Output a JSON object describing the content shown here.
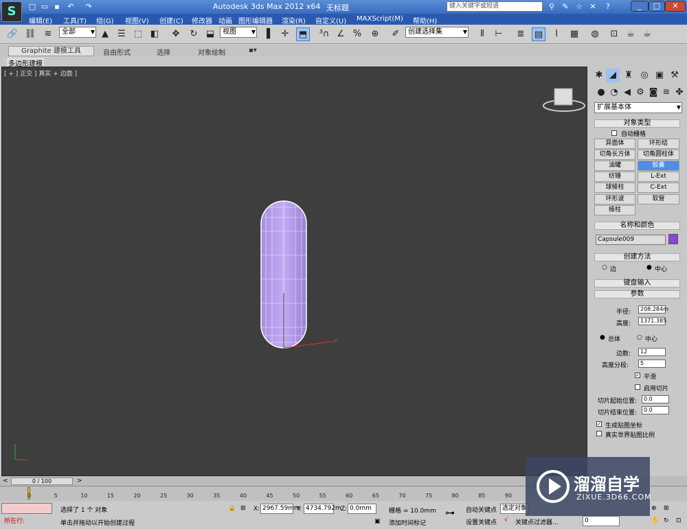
{
  "titlebar": {
    "title": "Autodesk 3ds Max  2012 x64",
    "file": "无标题",
    "search_placeholder": "键入关键字或短语"
  },
  "menu": [
    "编辑(E)",
    "工具(T)",
    "组(G)",
    "视图(V)",
    "创建(C)",
    "修改器",
    "动画",
    "图形编辑器",
    "渲染(R)",
    "自定义(U)",
    "MAXScript(M)",
    "帮助(H)"
  ],
  "toolbar": {
    "select_filter": "全部",
    "ref_coord": "视图",
    "named_selection": "创建选择集"
  },
  "ribbon": {
    "tabs": [
      "Graphite 建模工具",
      "自由形式",
      "选择",
      "对象绘制"
    ],
    "sub": "多边形建模"
  },
  "viewport": {
    "label": "[ + ] 正交 ] 真实 + 边面 ]"
  },
  "panel": {
    "category": "扩展基本体",
    "object_type_header": "对象类型",
    "autogrid": "自动栅格",
    "buttons": [
      "异面体",
      "环形结",
      "切角长方体",
      "切角圆柱体",
      "油罐",
      "胶囊",
      "纺锤",
      "L-Ext",
      "球棱柱",
      "C-Ext",
      "环形波",
      "软管",
      "棱柱"
    ],
    "name_color_header": "名称和颜色",
    "object_name": "Capsule009",
    "object_color": "#8e44d8",
    "creation_method_header": "创建方法",
    "method_edge": "边",
    "method_center": "中心",
    "keyboard_header": "键盘输入",
    "params_header": "参数",
    "radius_label": "半径:",
    "radius_value": "208.284m",
    "height_label": "高度:",
    "height_value": "1371.385",
    "total": "总体",
    "center": "中心",
    "sides_label": "边数:",
    "sides_value": "12",
    "hsegs_label": "高度分段:",
    "hsegs_value": "5",
    "smooth": "平滑",
    "slice_on": "启用切片",
    "slice_from_label": "切片起始位置:",
    "slice_from_value": "0.0",
    "slice_to_label": "切片结束位置:",
    "slice_to_value": "0.0",
    "gen_map": "生成贴图坐标",
    "real_world": "真实世界贴图比例"
  },
  "timeline": {
    "frame": "0 / 100",
    "ticks": [
      "0",
      "5",
      "10",
      "15",
      "20",
      "25",
      "30",
      "35",
      "40",
      "45",
      "50",
      "55",
      "60",
      "65",
      "70",
      "75",
      "80",
      "85",
      "90"
    ]
  },
  "status": {
    "running": "所在行:",
    "selected": "选择了 1 个 对象",
    "prompt": "单击并拖动以开始创建过程",
    "x_label": "X:",
    "x_value": "2967.59mm",
    "y_label": "Y:",
    "y_value": "4734.792m",
    "z_label": "Z:",
    "z_value": "0.0mm",
    "grid": "栅格 = 10.0mm",
    "add_time_tag": "添加时间标记",
    "auto_key": "自动关键点",
    "auto_key_sel": "选定对象",
    "set_key": "设置关键点",
    "key_filters": "关键点过滤器...",
    "frame_field": "0"
  },
  "watermark": {
    "brand": "溜溜自学",
    "url": "ZIXUE.3D66.COM"
  }
}
